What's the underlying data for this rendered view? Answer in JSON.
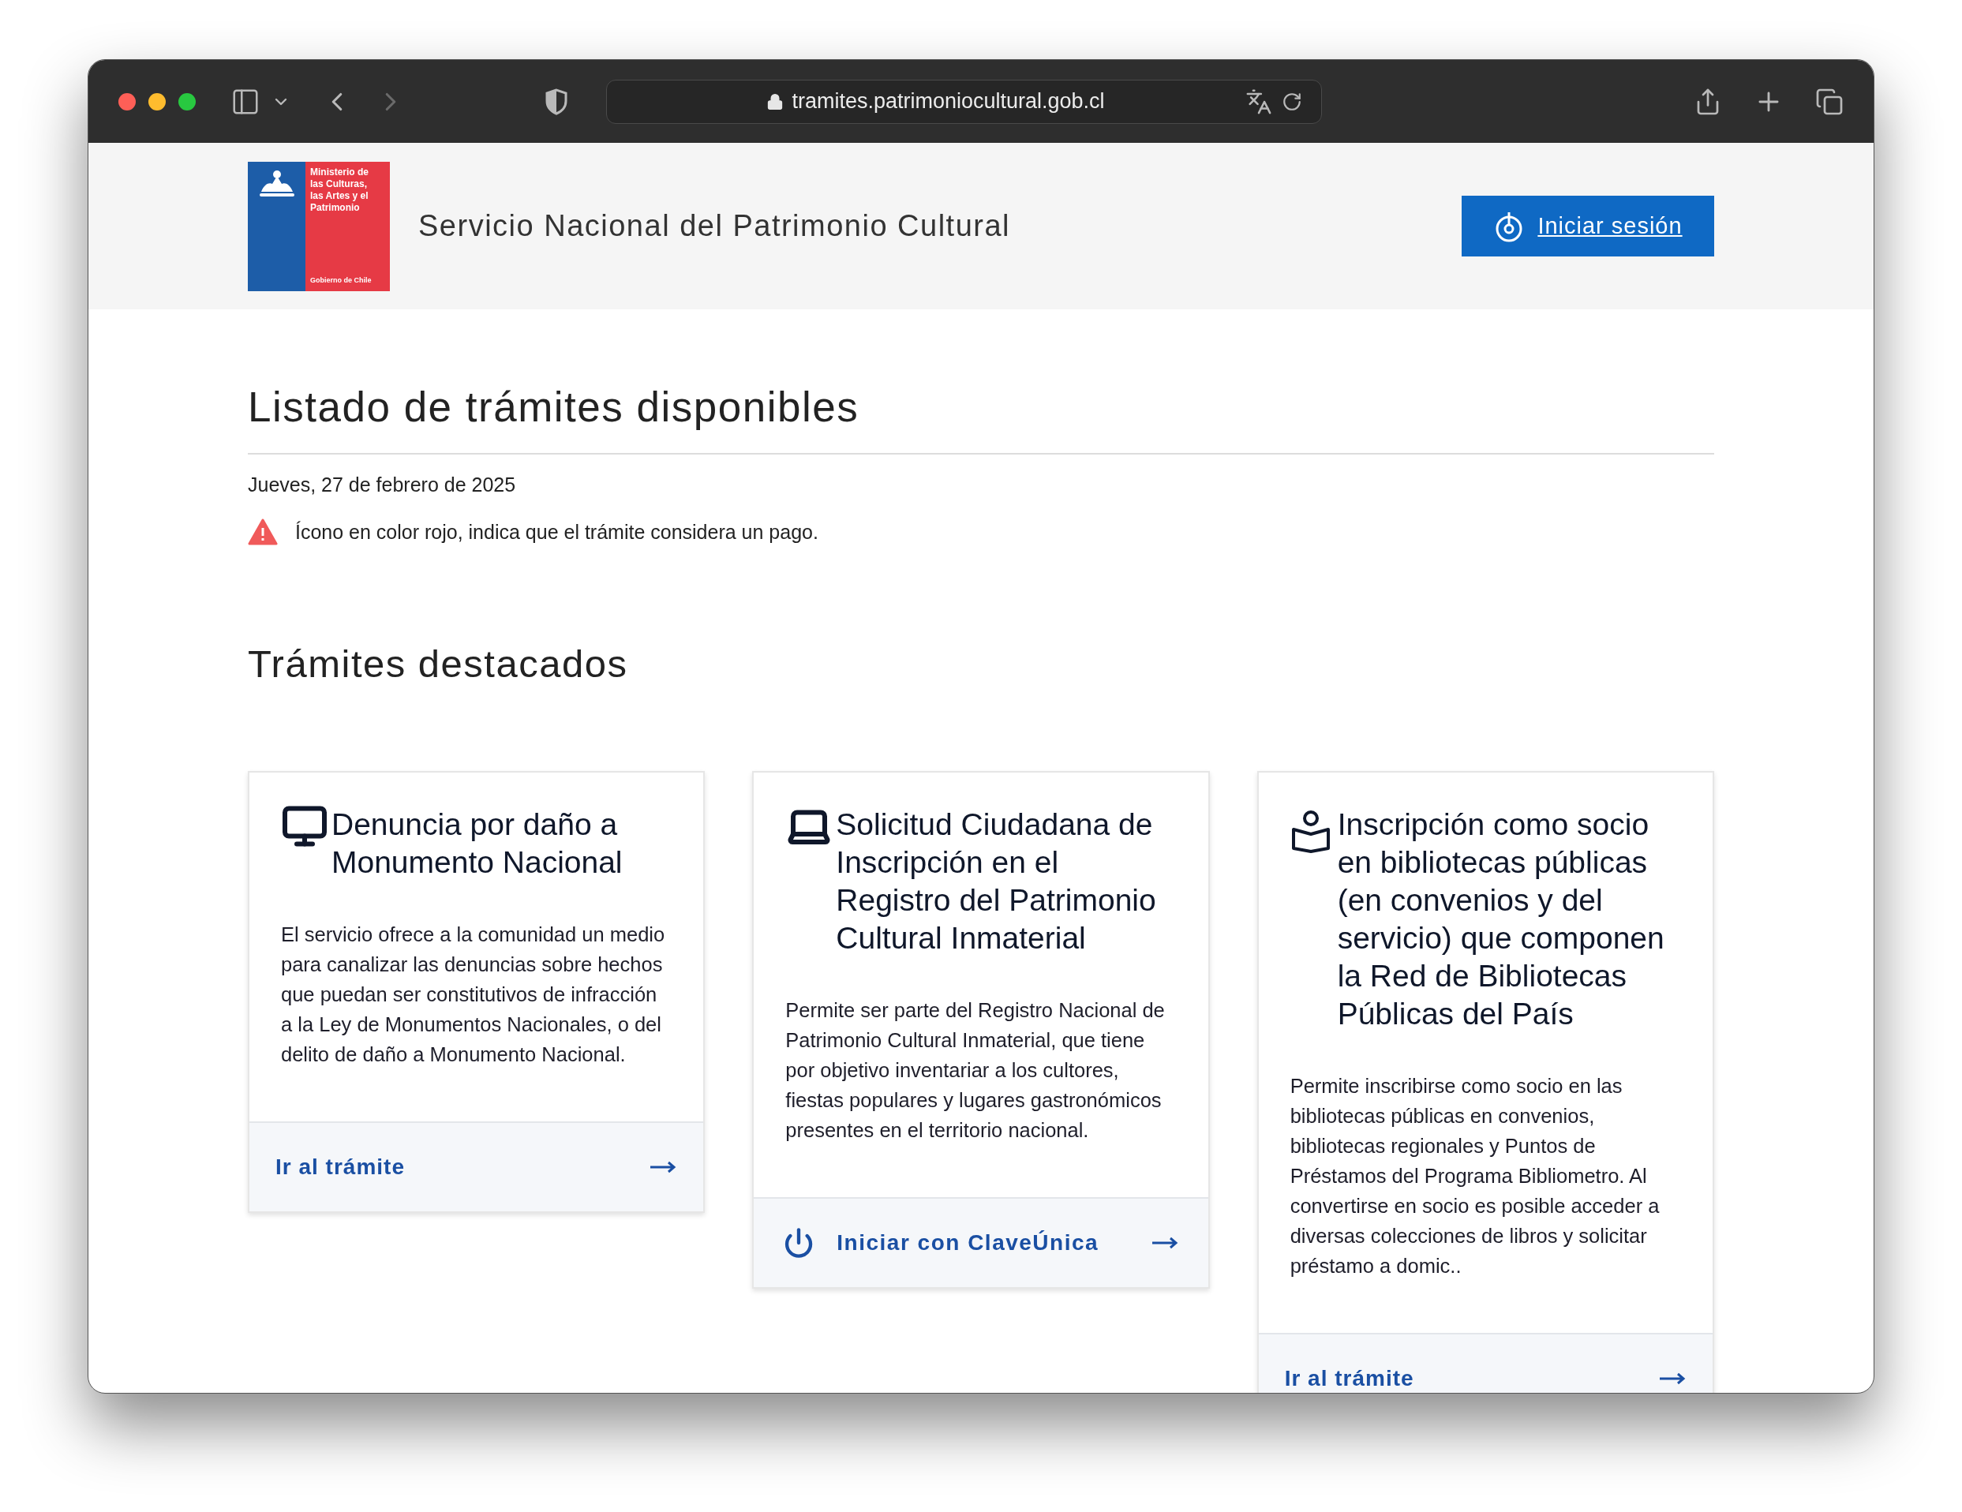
{
  "browser": {
    "url": "tramites.patrimoniocultural.gob.cl"
  },
  "header": {
    "logo": {
      "lines": [
        "Ministerio de",
        "las Culturas,",
        "las Artes y el",
        "Patrimonio"
      ],
      "footer": "Gobierno de Chile"
    },
    "title": "Servicio Nacional del Patrimonio Cultural",
    "login_button": "Iniciar sesión"
  },
  "main": {
    "title": "Listado de trámites disponibles",
    "date": "Jueves, 27 de febrero de 2025",
    "notice": "Ícono en color rojo, indica que el trámite considera un pago.",
    "section_title": "Trámites destacados",
    "cards": [
      {
        "kind": "monitor",
        "title": "Denuncia por daño a Monumento Nacional",
        "description": "El servicio ofrece a la comunidad un medio para canalizar las denuncias sobre hechos que puedan ser constitutivos de infracción a la Ley de Monumentos Nacionales, o del delito de daño a Monumento Nacional.",
        "action": {
          "kind": "link",
          "label": "Ir al trámite"
        }
      },
      {
        "kind": "laptop",
        "title": "Solicitud Ciudadana de Inscripción en el Registro del Patrimonio Cultural Inmaterial",
        "description": "Permite ser parte del Registro Nacional de Patrimonio Cultural Inmaterial, que tiene por objetivo inventariar a los cultores, fiestas populares y lugares gastronómicos presentes en el territorio nacional.",
        "action": {
          "kind": "claveunica",
          "label": "Iniciar con ClaveÚnica"
        }
      },
      {
        "kind": "book-person",
        "title": "Inscripción como socio en bibliotecas públicas (en convenios y del servicio) que componen la Red de Bibliotecas Públicas del País",
        "description": "Permite inscribirse como socio en las bibliotecas públicas en convenios, bibliotecas regionales y Puntos de Préstamos del Programa Bibliometro. Al convertirse en socio es posible acceder a diversas colecciones de libros y solicitar préstamo a domic..",
        "action": {
          "kind": "link",
          "label": "Ir al trámite"
        }
      }
    ]
  }
}
